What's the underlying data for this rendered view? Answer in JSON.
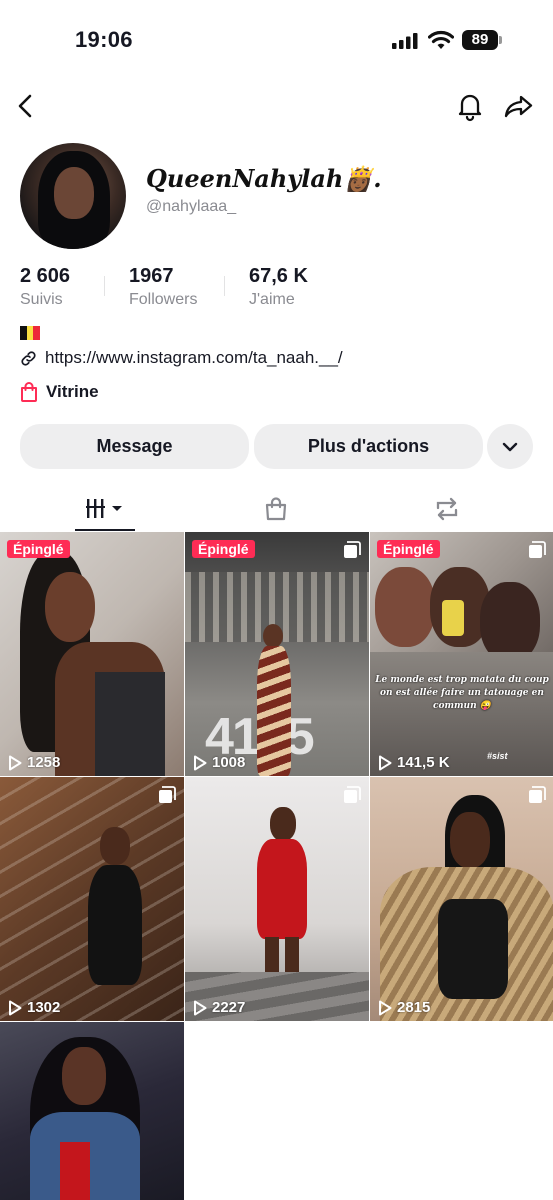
{
  "status_bar": {
    "time": "19:06",
    "battery": "89"
  },
  "profile": {
    "display_name": "QueenNahylah👸🏾.",
    "username": "@nahylaaa_",
    "stats": [
      {
        "value": "2 606",
        "label": "Suivis"
      },
      {
        "value": "1967",
        "label": "Followers"
      },
      {
        "value": "67,6 K",
        "label": "J'aime"
      }
    ],
    "bio_flag": "belgium-flag",
    "link": "https://www.instagram.com/ta_naah.__/",
    "vitrine": "Vitrine"
  },
  "actions": {
    "message": "Message",
    "more": "Plus d'actions"
  },
  "tabs": [
    "videos-grid-icon",
    "shop-bag-icon",
    "repost-icon"
  ],
  "colors": {
    "accent": "#fe2c55",
    "text": "#161823",
    "muted": "#8a8b91",
    "button_bg": "#eeeeef"
  },
  "videos": [
    {
      "pinned": "Épinglé",
      "views": "1258",
      "multi": false
    },
    {
      "pinned": "Épinglé",
      "views": "1008",
      "multi": true
    },
    {
      "pinned": "Épinglé",
      "views": "141,5 K",
      "multi": true,
      "caption": "Le monde est trop matata du coup on est allée faire un tatouage en commun 😜",
      "hashtag": "#sist"
    },
    {
      "pinned": "",
      "views": "1302",
      "multi": true
    },
    {
      "pinned": "",
      "views": "2227",
      "multi": true
    },
    {
      "pinned": "",
      "views": "2815",
      "multi": true
    },
    {
      "pinned": "",
      "views": "",
      "multi": false
    }
  ]
}
